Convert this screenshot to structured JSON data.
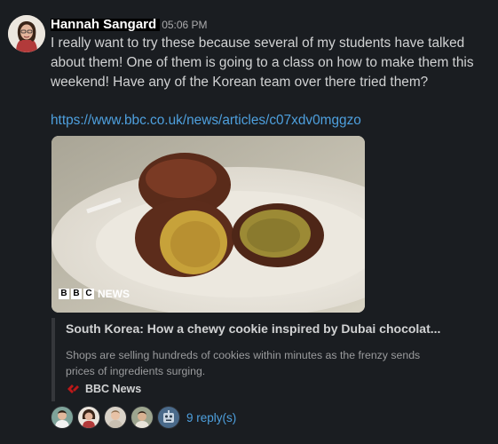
{
  "message": {
    "author": "Hannah Sangard",
    "time": "05:06 PM",
    "text": "I really want to try these because several of my students have talked about them! One of them is going to a class on how to make them this weekend! Have any of the Korean team over there tried them?",
    "link": "https://www.bbc.co.uk/news/articles/c07xdv0mggzo"
  },
  "preview": {
    "image_logo_letters": [
      "B",
      "B",
      "C"
    ],
    "image_logo_word": "NEWS",
    "title": "South Korea: How a chewy cookie inspired by Dubai chocolat...",
    "description": "Shops are selling hundreds of cookies within minutes as the frenzy sends prices of ingredients surging.",
    "source_name": "BBC News",
    "source_icon": "bbc-news-icon"
  },
  "thread": {
    "reply_count_label": "9 reply(s)",
    "avatars": [
      "avatar-1",
      "avatar-2",
      "avatar-3",
      "avatar-4",
      "avatar-5"
    ]
  },
  "colors": {
    "background": "#1a1d21",
    "link": "#4ea0de",
    "text": "#d1d2d3",
    "muted": "#9a9b9d"
  }
}
